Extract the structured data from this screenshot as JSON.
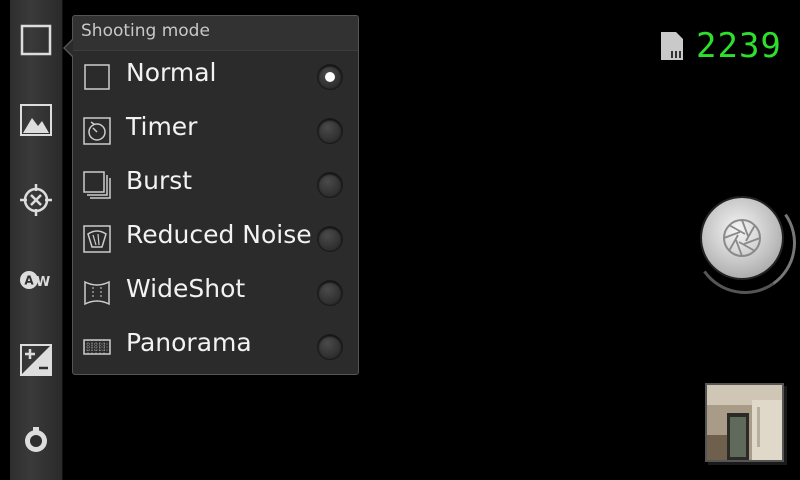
{
  "popup": {
    "title": "Shooting mode",
    "modes": [
      {
        "label": "Normal",
        "icon": "normal-square-icon",
        "selected": true
      },
      {
        "label": "Timer",
        "icon": "timer-icon",
        "selected": false
      },
      {
        "label": "Burst",
        "icon": "burst-stack-icon",
        "selected": false
      },
      {
        "label": "Reduced Noise",
        "icon": "reduced-noise-icon",
        "selected": false
      },
      {
        "label": "WideShot",
        "icon": "wideshot-icon",
        "selected": false
      },
      {
        "label": "Panorama",
        "icon": "panorama-icon",
        "selected": false
      }
    ]
  },
  "sidebar": {
    "items": [
      {
        "icon": "shooting-mode-icon"
      },
      {
        "icon": "scene-landscape-icon"
      },
      {
        "icon": "focus-mode-icon"
      },
      {
        "icon": "auto-white-balance-icon",
        "label": "AW"
      },
      {
        "icon": "exposure-compensation-icon"
      },
      {
        "icon": "camera-settings-icon"
      }
    ]
  },
  "status": {
    "remaining_shots": "2239",
    "storage_icon": "sd-card-icon"
  },
  "controls": {
    "shutter_icon": "shutter-aperture-icon",
    "thumbnail_icon": "last-photo-thumbnail"
  },
  "colors": {
    "counter": "#2de02d",
    "background": "#000000",
    "popup_bg": "#2b2b2b"
  }
}
